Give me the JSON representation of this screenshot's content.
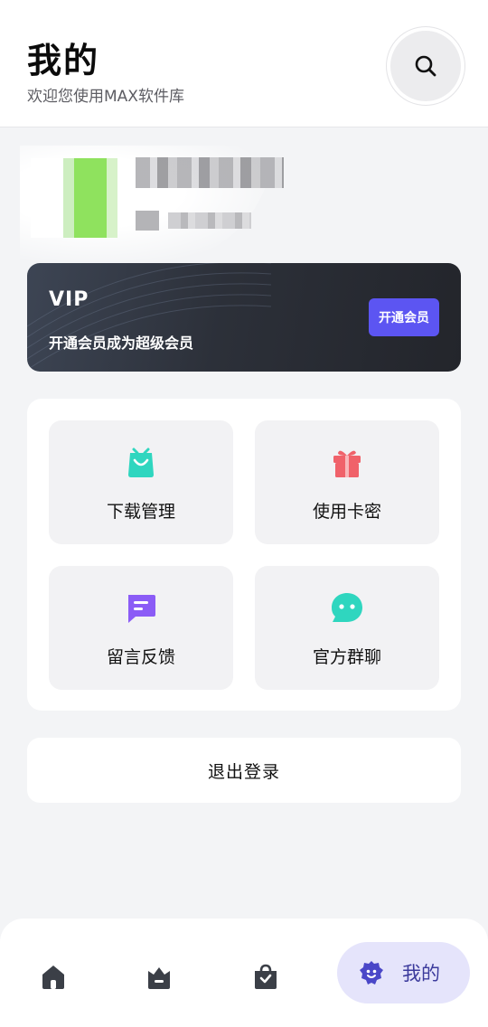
{
  "header": {
    "title": "我的",
    "subtitle": "欢迎您使用MAX软件库",
    "search_icon": "search-icon"
  },
  "vip": {
    "title": "VIP",
    "description": "开通会员成为超级会员",
    "button_label": "开通会员"
  },
  "menu": {
    "items": [
      {
        "label": "下载管理",
        "icon": "shopping-bag-icon",
        "color": "#2fd6bf"
      },
      {
        "label": "使用卡密",
        "icon": "gift-icon",
        "color": "#f0626a"
      },
      {
        "label": "留言反馈",
        "icon": "message-icon",
        "color": "#8b5cf6"
      },
      {
        "label": "官方群聊",
        "icon": "chat-bubble-icon",
        "color": "#2fd6bf"
      }
    ]
  },
  "logout_label": "退出登录",
  "bottom_nav": {
    "items": [
      {
        "icon": "home-icon"
      },
      {
        "icon": "crown-icon"
      },
      {
        "icon": "bag-icon"
      }
    ],
    "active": {
      "icon": "profile-icon",
      "label": "我的"
    }
  },
  "colors": {
    "accent": "#5c55f2",
    "active_tab_bg": "#e5e4fb",
    "background": "#f3f4f6"
  }
}
